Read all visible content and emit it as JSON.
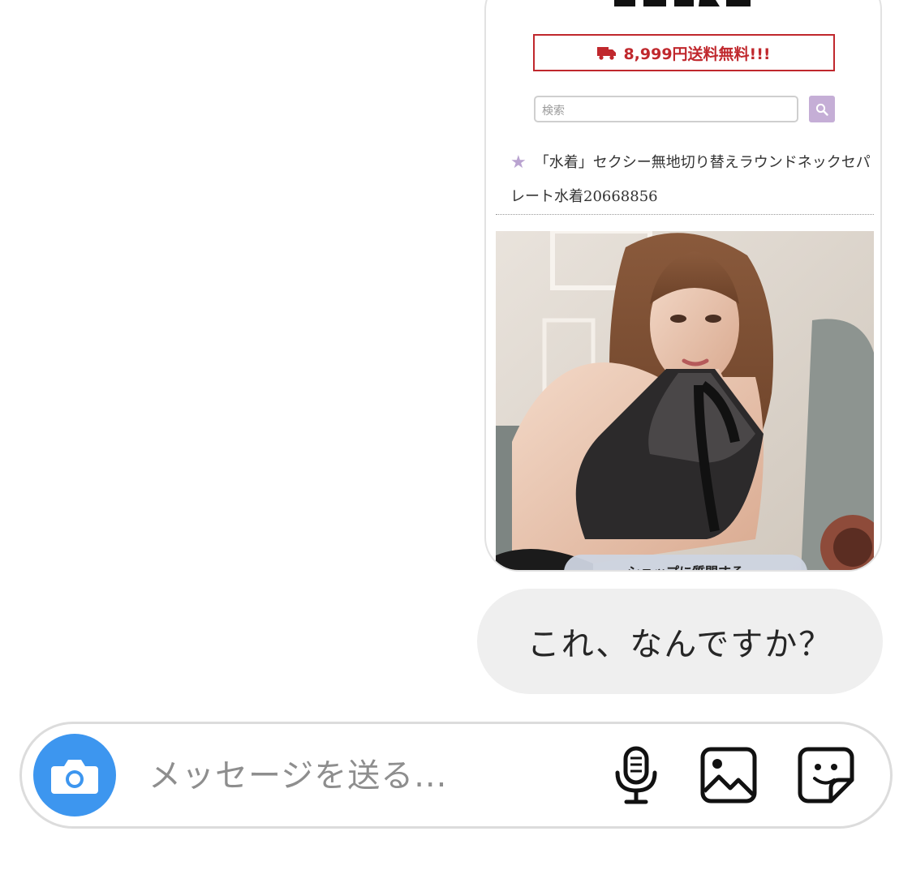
{
  "shared_post": {
    "shipping_banner": "8,999円送料無料!!!",
    "search": {
      "placeholder": "検索"
    },
    "product_title": "「水着」セクシー無地切り替えラウンドネックセパレート水着20668856",
    "product_image_icon": "product-photo",
    "shop_pill_label": "ショップに質問する",
    "colors": {
      "banner_red": "#c0282d",
      "search_button": "#c5aed6",
      "star": "#b9a3d0"
    }
  },
  "message": {
    "text": "これ、なんですか？"
  },
  "composer": {
    "placeholder": "メッセージを送る...",
    "icons": [
      "camera-icon",
      "microphone-icon",
      "gallery-icon",
      "sticker-icon"
    ],
    "accent_color": "#3d96ef"
  }
}
